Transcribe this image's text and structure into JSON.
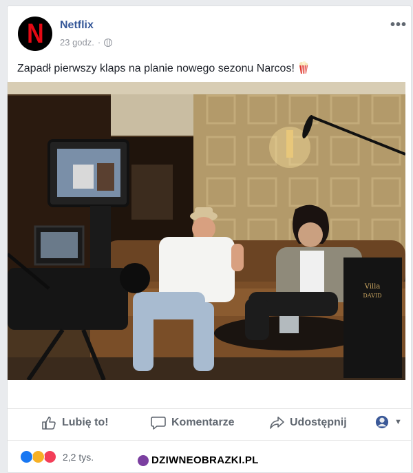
{
  "post": {
    "page_name": "Netflix",
    "avatar_letter": "N",
    "time": "23 godz.",
    "dot": "·",
    "more_label": "•••",
    "text": "Zapadł pierwszy klaps na planie nowego sezonu Narcos!",
    "photo_sign_line1": "Villa",
    "photo_sign_line2": "DAVID"
  },
  "actions": {
    "like": "Lubię to!",
    "comment": "Komentarze",
    "share": "Udostępnij"
  },
  "reactions": {
    "count": "2,2 tys."
  },
  "watermark": {
    "text": "DZIWNEOBRAZKI.PL"
  },
  "colors": {
    "link": "#365899",
    "netflix_red": "#e50914",
    "like_blue": "#1877f2",
    "love_red": "#f33e58",
    "haha_yellow": "#f7b125"
  }
}
